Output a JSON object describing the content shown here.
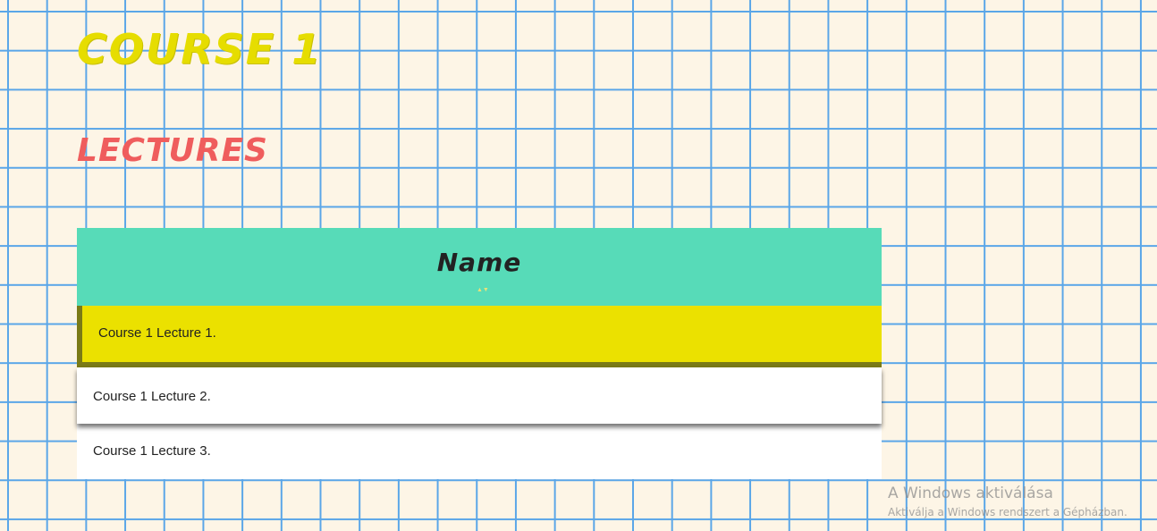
{
  "page": {
    "course_title": "Course 1",
    "section_title": "Lectures"
  },
  "table": {
    "header": "Name",
    "sort_icon": "sort-arrows-icon",
    "rows": [
      {
        "name": "Course 1 Lecture 1."
      },
      {
        "name": "Course 1 Lecture 2."
      },
      {
        "name": "Course 1 Lecture 3."
      }
    ]
  },
  "watermark": {
    "title": "A Windows aktiválása",
    "subtitle": "Aktiválja a Windows rendszert a Gépházban."
  },
  "colors": {
    "background": "#fdf5e6",
    "grid": "#5aa6e8",
    "course_title": "#e6dd00",
    "section_title": "#ef5d5d",
    "header_bg": "#57dbb8",
    "active_row": "#ebe100",
    "active_row_border": "#7a7a16"
  }
}
